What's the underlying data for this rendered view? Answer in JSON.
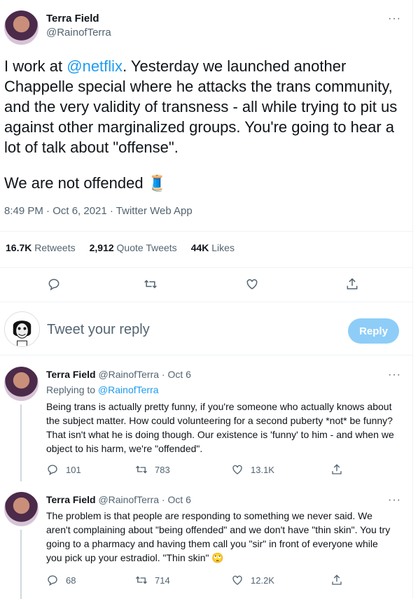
{
  "main_tweet": {
    "display_name": "Terra Field",
    "handle": "@RainofTerra",
    "text_part1": "I work at ",
    "mention": "@netflix",
    "text_part2": ". Yesterday we launched another Chappelle special where he attacks the trans community, and the very validity of transness - all while trying to pit us against other marginalized groups. You're going to hear a lot of talk about \"offense\".",
    "text_part3": "We are not offended",
    "emoji": "🧵",
    "meta": "8:49 PM · Oct 6, 2021 · Twitter Web App",
    "stats": [
      {
        "value": "16.7K",
        "label": "Retweets"
      },
      {
        "value": "2,912",
        "label": "Quote Tweets"
      },
      {
        "value": "44K",
        "label": "Likes"
      }
    ]
  },
  "compose": {
    "placeholder": "Tweet your reply",
    "button": "Reply"
  },
  "replies": [
    {
      "display_name": "Terra Field",
      "handle": "@RainofTerra",
      "time": "· Oct 6",
      "replying_to_label": "Replying to",
      "replying_to": "@RainofTerra",
      "text": "Being trans is actually pretty funny, if you're someone who actually knows about the subject matter. How could volunteering for a second puberty *not* be funny? That isn't what he is doing though. Our existence is 'funny' to him - and when we object to his harm, we're \"offended\".",
      "replies": "101",
      "retweets": "783",
      "likes": "13.1K"
    },
    {
      "display_name": "Terra Field",
      "handle": "@RainofTerra",
      "time": "· Oct 6",
      "text": "The problem is that people are responding to something we never said. We aren't complaining about \"being offended\" and we don't have \"thin skin\". You try going to a pharmacy and having them call you \"sir\" in front of everyone while you pick up your estradiol. \"Thin skin\"",
      "emoji": "🙄",
      "replies": "68",
      "retweets": "714",
      "likes": "12.2K"
    }
  ],
  "colors": {
    "accent": "#1d9bf0",
    "reply_button": "#8ecdf8",
    "muted": "#536471"
  }
}
